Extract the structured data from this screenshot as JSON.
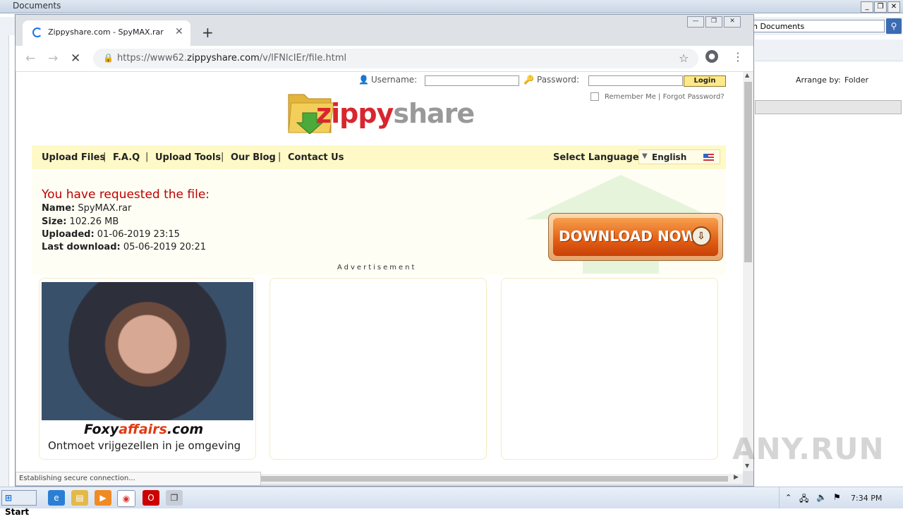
{
  "explorer": {
    "title": "Documents",
    "search_placeholder": "h Documents",
    "arrange_label": "Arrange by:",
    "arrange_value": "Folder"
  },
  "browser": {
    "tab_title": "Zippyshare.com - SpyMAX.rar",
    "url_prefix": "https://www62.",
    "url_host": "zippyshare.com",
    "url_path": "/v/lFNlcIEr/file.html",
    "status_text": "Establishing secure connection..."
  },
  "login": {
    "username_label": "Username:",
    "password_label": "Password:",
    "login_button": "Login",
    "remember_me": "Remember Me",
    "forgot_password": "Forgot Password?"
  },
  "logo": {
    "part1": "zippy",
    "part2": "share"
  },
  "nav": {
    "items": [
      "Upload Files",
      "F.A.Q",
      "Upload Tools",
      "Our Blog",
      "Contact Us"
    ],
    "language_label": "Select Language:",
    "language_value": "English"
  },
  "file": {
    "heading": "You have requested the file:",
    "name_label": "Name:",
    "name": "SpyMAX.rar",
    "size_label": "Size:",
    "size": "102.26 MB",
    "uploaded_label": "Uploaded:",
    "uploaded": "01-06-2019 23:15",
    "last_download_label": "Last download:",
    "last_download": "05-06-2019 20:21",
    "download_button": "DOWNLOAD NOW"
  },
  "ads": {
    "label": "Advertisement",
    "brand_part1": "Foxy",
    "brand_part2": "affairs",
    "brand_part3": ".com",
    "tagline": "Ontmoet vrijgezellen in je omgeving"
  },
  "taskbar": {
    "start_label": "Start",
    "clock": "7:34 PM"
  },
  "watermark": "ANY.RUN",
  "colors": {
    "brand_red": "#d9262e",
    "nav_bg": "#fff9c7",
    "download_orange": "#e25d13",
    "heading_red": "#b00"
  }
}
